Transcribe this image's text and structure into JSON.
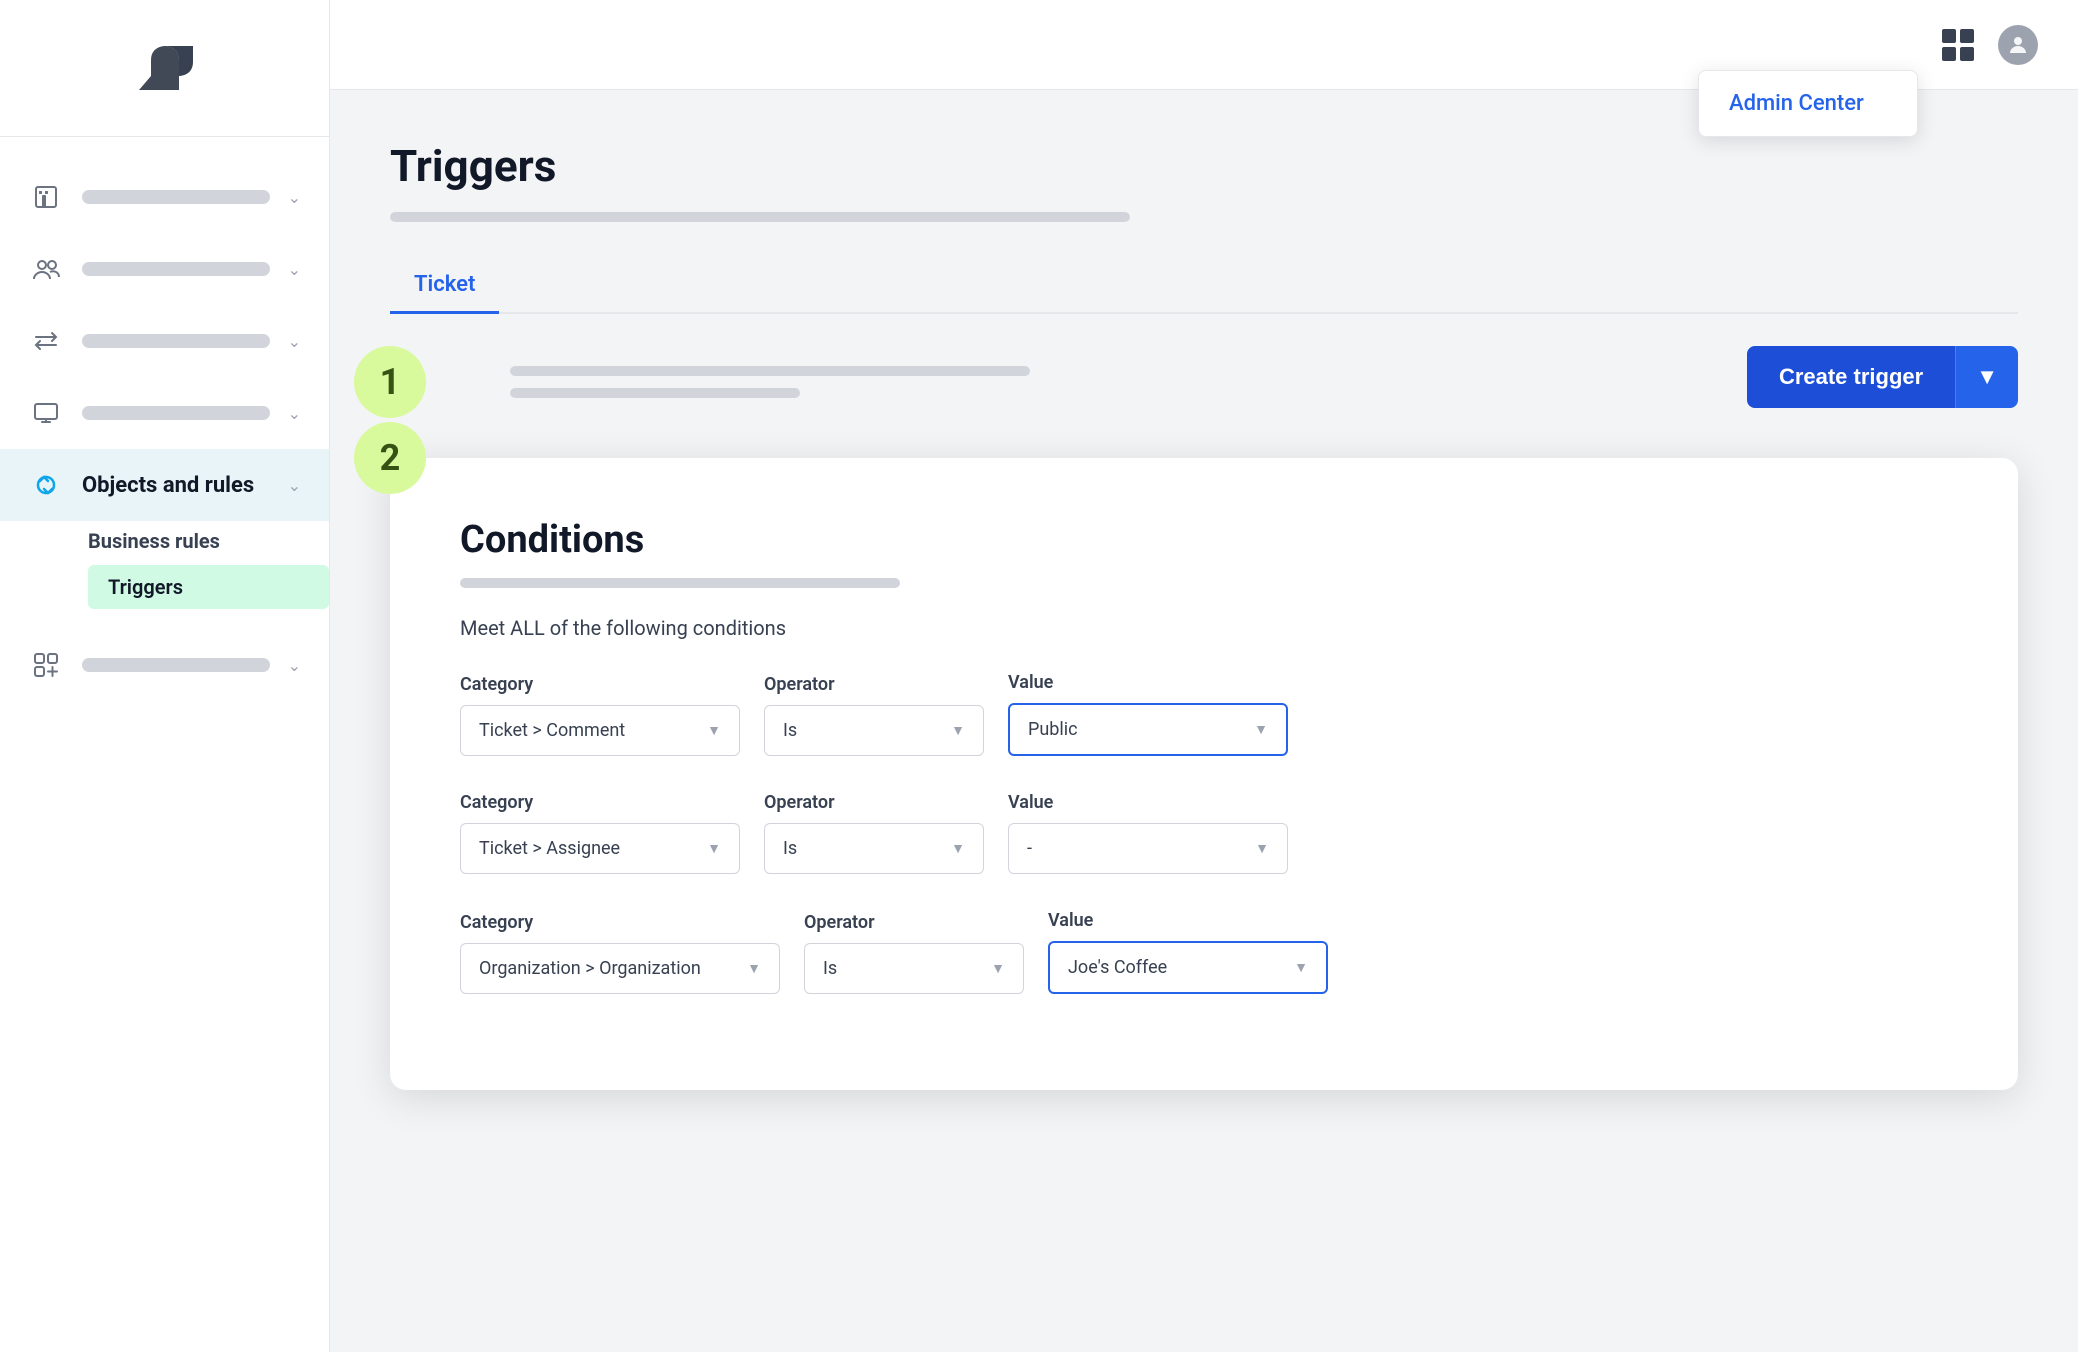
{
  "sidebar": {
    "logo_alt": "Zendesk Logo",
    "nav_items": [
      {
        "id": "workspace",
        "label": "",
        "active": false,
        "icon": "building-icon"
      },
      {
        "id": "people",
        "label": "",
        "active": false,
        "icon": "people-icon"
      },
      {
        "id": "channels",
        "label": "",
        "active": false,
        "icon": "channels-icon"
      },
      {
        "id": "workspace2",
        "label": "",
        "active": false,
        "icon": "monitor-icon"
      },
      {
        "id": "objects-and-rules",
        "label": "Objects and rules",
        "active": true,
        "icon": "objects-rules-icon"
      },
      {
        "id": "apps",
        "label": "",
        "active": false,
        "icon": "apps-icon"
      }
    ],
    "sub_nav": {
      "section": "Business rules",
      "items": [
        {
          "id": "triggers",
          "label": "Triggers",
          "active": true
        }
      ]
    }
  },
  "topbar": {
    "grid_icon_label": "Apps",
    "user_icon_label": "User profile",
    "admin_dropdown": {
      "visible": true,
      "items": [
        {
          "id": "admin-center",
          "label": "Admin Center"
        }
      ]
    }
  },
  "page": {
    "title": "Triggers",
    "tabs": [
      {
        "id": "ticket",
        "label": "Ticket",
        "active": true
      }
    ]
  },
  "trigger_area": {
    "step_badge": "1",
    "create_button_label": "Create trigger",
    "chevron_label": "▾"
  },
  "conditions_card": {
    "step_badge": "2",
    "title": "Conditions",
    "meet_all_text": "Meet ALL of the following conditions",
    "rows": [
      {
        "category_label": "Category",
        "category_value": "Ticket > Comment",
        "operator_label": "Operator",
        "operator_value": "Is",
        "value_label": "Value",
        "value_value": "Public",
        "value_highlighted": true
      },
      {
        "category_label": "Category",
        "category_value": "Ticket > Assignee",
        "operator_label": "Operator",
        "operator_value": "Is",
        "value_label": "Value",
        "value_value": "-",
        "value_highlighted": false
      },
      {
        "category_label": "Category",
        "category_value": "Organization > Organization",
        "operator_label": "Operator",
        "operator_value": "Is",
        "value_label": "Value",
        "value_value": "Joe's Coffee",
        "value_highlighted": true
      }
    ]
  }
}
